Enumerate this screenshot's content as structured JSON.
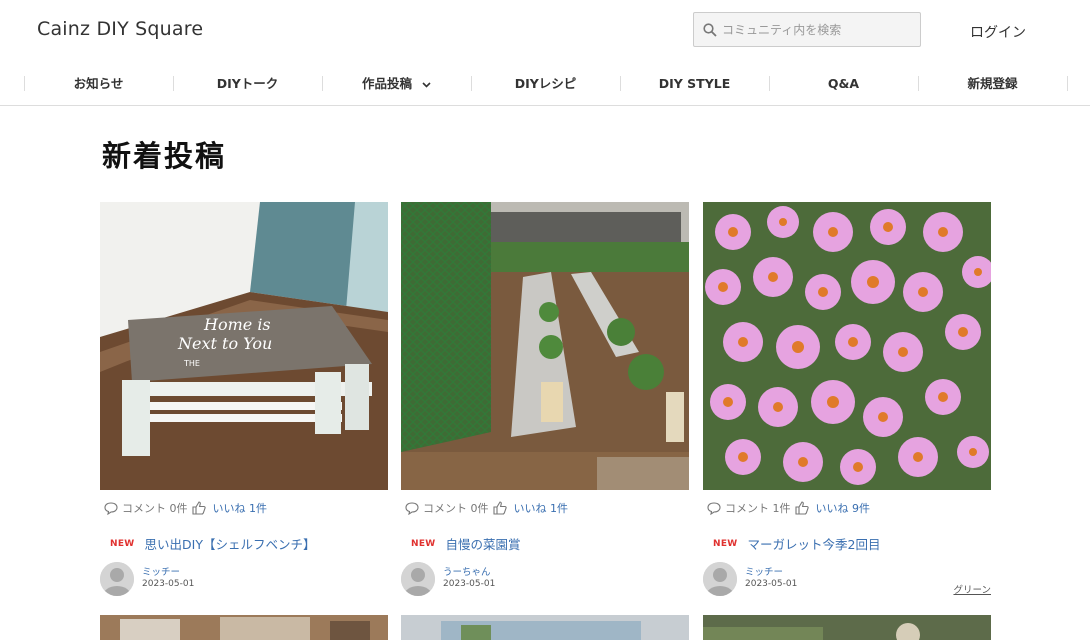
{
  "header": {
    "logo": "Cainz DIY Square",
    "search_placeholder": "コミュニティ内を検索",
    "login": "ログイン"
  },
  "nav": {
    "items": [
      {
        "label": "お知らせ"
      },
      {
        "label": "DIYトーク"
      },
      {
        "label": "作品投稿",
        "has_dropdown": true
      },
      {
        "label": "DIYレシピ"
      },
      {
        "label": "DIY STYLE"
      },
      {
        "label": "Q&A"
      },
      {
        "label": "新規登録"
      }
    ]
  },
  "main": {
    "title": "新着投稿",
    "posts": [
      {
        "comment_text": "コメント 0件",
        "like_text": "いいね 1件",
        "badge": "NEW",
        "title": "思い出DIY【シェルフベンチ】",
        "user": "ミッチー",
        "date": "2023-05-01",
        "image": "bench-photo"
      },
      {
        "comment_text": "コメント 0件",
        "like_text": "いいね 1件",
        "badge": "NEW",
        "title": "自慢の菜園賞",
        "user": "うーちゃん",
        "date": "2023-05-01",
        "image": "vegetable-garden-photo"
      },
      {
        "comment_text": "コメント 1件",
        "like_text": "いいね 9件",
        "badge": "NEW",
        "title": "マーガレット今季2回目",
        "user": "ミッチー",
        "date": "2023-05-01",
        "tag": "グリーン",
        "image": "marguerite-flowers-photo"
      }
    ]
  },
  "colors": {
    "link": "#3a6fb0",
    "new_badge": "#e0312f",
    "border": "#dddddd"
  }
}
